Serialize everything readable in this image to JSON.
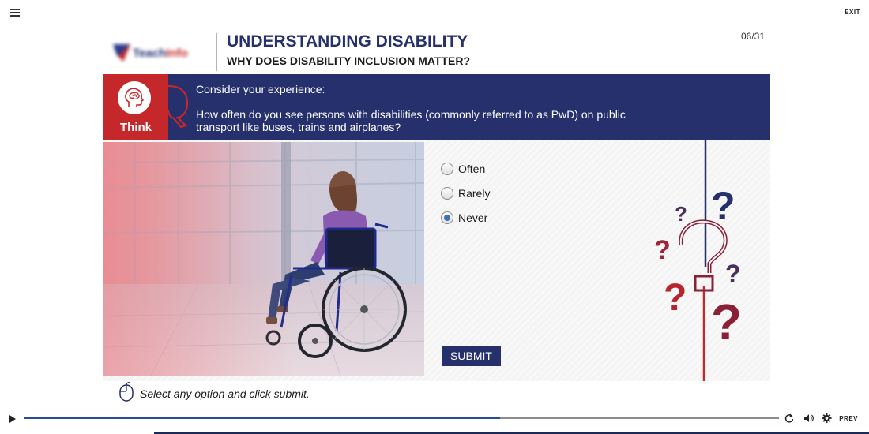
{
  "header": {
    "menu_icon": "hamburger-icon",
    "exit_label": "EXIT",
    "logo_text_1": "Teach",
    "logo_text_2": "Info",
    "title": "UNDERSTANDING DISABILITY",
    "subtitle": "WHY DOES DISABILITY INCLUSION MATTER?",
    "page_counter": "06/31"
  },
  "banner": {
    "think_label": "Think",
    "think_icon": "brain-head-icon",
    "heading": "Consider your experience:",
    "question": "How often do you see persons with disabilities (commonly referred to as PwD) on public transport like buses, trains and airplanes?"
  },
  "options": [
    {
      "label": "Often",
      "selected": false
    },
    {
      "label": "Rarely",
      "selected": false
    },
    {
      "label": "Never",
      "selected": true
    }
  ],
  "submit_label": "SUBMIT",
  "instruction": {
    "icon": "mouse-icon",
    "text": "Select any option and click submit."
  },
  "player": {
    "progress": 0.63,
    "prev_label": "PREV",
    "icons": [
      "play-icon",
      "replay-icon",
      "volume-icon",
      "settings-icon"
    ]
  },
  "colors": {
    "navy": "#25306c",
    "red": "#c4282a",
    "maroon": "#8a2036",
    "purple": "#4a2e5e"
  }
}
